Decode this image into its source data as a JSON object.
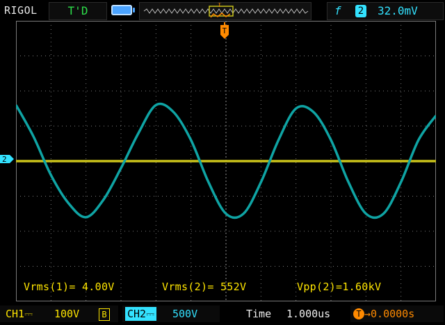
{
  "header": {
    "brand": "RIGOL",
    "status": "T'D",
    "trigger": {
      "edge_symbol": "f",
      "source": "2",
      "level": "32.0mV"
    }
  },
  "measurements": [
    {
      "text": "Vrms(1)= 4.00V"
    },
    {
      "text": "Vrms(2)= 552V"
    },
    {
      "text": "Vpp(2)=1.60kV"
    }
  ],
  "footer": {
    "ch1": {
      "label": "CH1",
      "coupling_symbol": "⎓",
      "scale": "100V",
      "bw_label": "B"
    },
    "ch2": {
      "label": "CH2",
      "coupling_symbol": "⎓",
      "scale": "500V"
    },
    "time": {
      "label": "Time",
      "value": "1.000us"
    },
    "trigger_offset": {
      "value": "0.0000s"
    }
  },
  "colors": {
    "ch1": "#c9c21a",
    "ch2": "#0fa4a4",
    "trigger": "#ff8a00",
    "grid": "#7b7b7b",
    "text_yellow": "#ffe600",
    "text_cyan": "#33e2ff"
  },
  "icons": {
    "battery": "battery-icon",
    "trigger_edge": "rising-edge-icon",
    "trigger_marker": "trigger-position-marker-icon",
    "channel_marker": "channel-ground-marker-icon",
    "trigger_offset": "trigger-offset-icon"
  },
  "chart_data": {
    "type": "line",
    "title": "",
    "xlabel": "",
    "ylabel": "",
    "grid": true,
    "xlim": [
      -6,
      6
    ],
    "ylim": [
      -4,
      4
    ],
    "series": [
      {
        "name": "CH1",
        "x": [
          -6,
          6
        ],
        "values": [
          0,
          0
        ]
      },
      {
        "name": "CH2",
        "x": [
          -6.0,
          -5.5,
          -5.0,
          -4.5,
          -4.0,
          -3.5,
          -3.0,
          -2.5,
          -2.0,
          -1.5,
          -1.0,
          -0.5,
          0.0,
          0.5,
          1.0,
          1.5,
          2.0,
          2.5,
          3.0,
          3.5,
          4.0,
          4.5,
          5.0,
          5.5,
          6.0
        ],
        "values": [
          1.6,
          0.7,
          -0.4,
          -1.2,
          -1.6,
          -1.1,
          -0.2,
          0.8,
          1.6,
          1.4,
          0.6,
          -0.6,
          -1.5,
          -1.5,
          -0.6,
          0.6,
          1.5,
          1.4,
          0.6,
          -0.6,
          -1.5,
          -1.5,
          -0.6,
          0.6,
          1.3
        ]
      }
    ]
  }
}
